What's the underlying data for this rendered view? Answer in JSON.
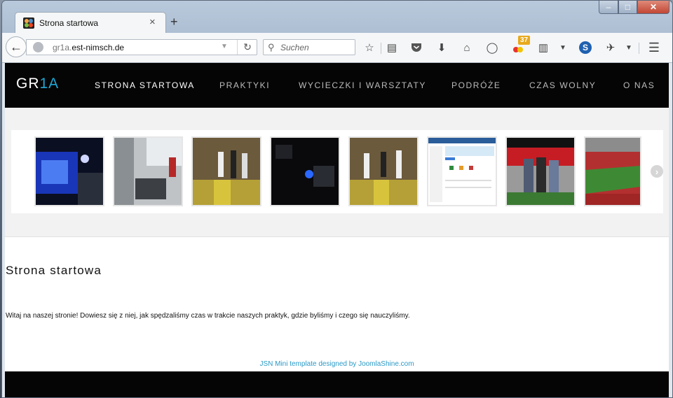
{
  "browser": {
    "tab_title": "Strona startowa",
    "tab_close": "×",
    "new_tab": "+",
    "url_prefix": "gr1a.",
    "url_domain": "est-nimsch.de",
    "search_placeholder": "Suchen",
    "badge_count": "37",
    "s_icon_letter": "S",
    "window_controls": {
      "minimize": "–",
      "maximize": "□",
      "close": "✕"
    }
  },
  "site": {
    "logo_main": "GR",
    "logo_highlight": "1A",
    "menu": [
      {
        "label": "STRONA STARTOWA",
        "active": true
      },
      {
        "label": "PRAKTYKI"
      },
      {
        "label": "WYCIECZKI I WARSZTATY"
      },
      {
        "label": "PODRÓŻE"
      },
      {
        "label": "CZAS WOLNY"
      },
      {
        "label": "O NAS"
      }
    ],
    "page_title": "Strona startowa",
    "intro": "Witaj na naszej stronie! Dowiesz się z niej, jak spędzaliśmy czas w trakcie naszych praktyk, gdzie byliśmy i czego się nauczyliśmy.",
    "footer_credit": "JSN Mini template designed by JoomlaShine.com"
  },
  "icons": [
    "back-arrow-icon",
    "globe-icon",
    "reload-icon",
    "search-icon",
    "bookmark-star-icon",
    "reading-list-icon",
    "pocket-icon",
    "download-icon",
    "home-icon",
    "chat-icon",
    "addon-badge-icon",
    "clipboard-icon",
    "s-addon-icon",
    "extension-icon",
    "menu-icon",
    "carousel-next-icon"
  ],
  "colors": {
    "accent": "#1fa7d4",
    "header_bg": "#050505",
    "footer_link": "#2a9ac7"
  }
}
